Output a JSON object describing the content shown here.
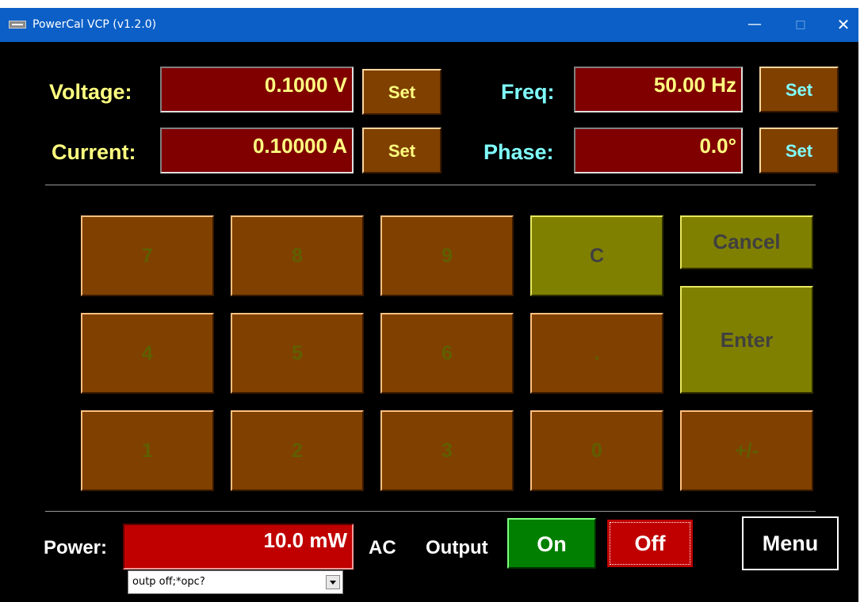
{
  "window": {
    "title": "PowerCal VCP  (v1.2.0)",
    "controls": {
      "minimize": "—",
      "maximize": "□",
      "close": "✕"
    }
  },
  "settings": {
    "voltage": {
      "label": "Voltage:",
      "value": "0.1000 V",
      "set_label": "Set"
    },
    "current": {
      "label": "Current:",
      "value": "0.10000 A",
      "set_label": "Set"
    },
    "freq": {
      "label": "Freq:",
      "value": "50.00 Hz",
      "set_label": "Set"
    },
    "phase": {
      "label": "Phase:",
      "value": "0.0°",
      "set_label": "Set"
    }
  },
  "keypad": {
    "k7": "7",
    "k8": "8",
    "k9": "9",
    "clear": "C",
    "cancel": "Cancel",
    "k4": "4",
    "k5": "5",
    "k6": "6",
    "dot": ".",
    "enter": "Enter",
    "k1": "1",
    "k2": "2",
    "k3": "3",
    "k0": "0",
    "sign": "+/-"
  },
  "bottom": {
    "power_label": "Power:",
    "power_value": "10.0 mW",
    "mode": "AC",
    "output_label": "Output",
    "on_label": "On",
    "off_label": "Off",
    "menu_label": "Menu",
    "command": "outp off;*opc?"
  },
  "colors": {
    "display_bg": "#800000",
    "power_bg": "#c00000",
    "key_bg": "#804000",
    "olive_key_bg": "#808000",
    "on_bg": "#007f00",
    "titlebar": "#0b5fc6"
  }
}
